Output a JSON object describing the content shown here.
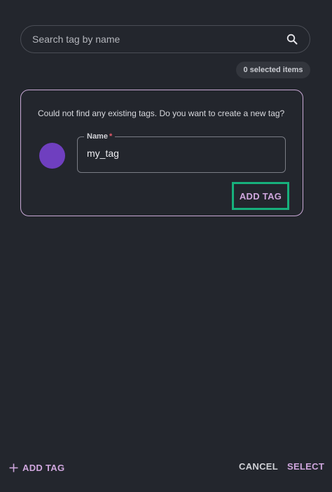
{
  "search": {
    "placeholder": "Search tag by name",
    "value": "",
    "icon": "search-icon"
  },
  "selection": {
    "badge": "0 selected items"
  },
  "create_card": {
    "message": "Could not find any existing tags. Do you want to create a new tag?",
    "swatch_color": "#6f3fbf",
    "name_label": "Name",
    "required_marker": "*",
    "name_value": "my_tag",
    "add_button": "ADD TAG",
    "highlight_color": "#17b07c"
  },
  "footer": {
    "add_tag": "ADD TAG",
    "add_icon": "plus-icon",
    "cancel": "CANCEL",
    "select": "SELECT"
  },
  "colors": {
    "background": "#23262d",
    "accent": "#cfa6dd"
  }
}
